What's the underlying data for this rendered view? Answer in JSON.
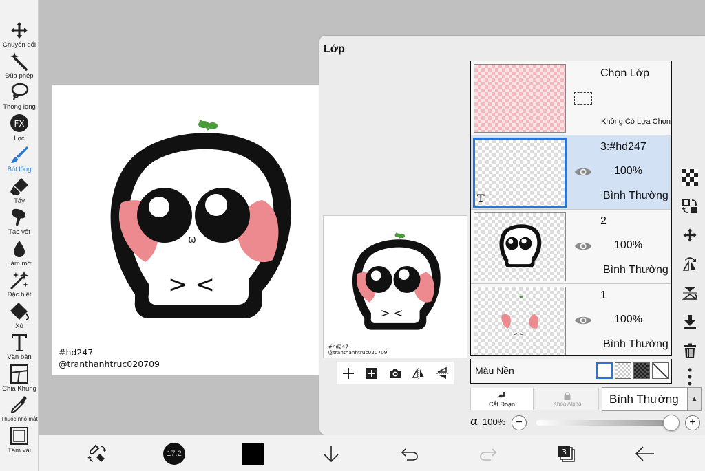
{
  "tools": [
    {
      "label": "Chuyển đổi",
      "icon": "move-arrows-icon",
      "active": false
    },
    {
      "label": "Đũa phép",
      "icon": "magic-wand-icon",
      "active": false
    },
    {
      "label": "Thòng lọng",
      "icon": "lasso-icon",
      "active": false
    },
    {
      "label": "Lọc",
      "icon": "fx-filter-icon",
      "active": false
    },
    {
      "label": "Bút lông",
      "icon": "brush-icon",
      "active": true
    },
    {
      "label": "Tẩy",
      "icon": "eraser-icon",
      "active": false
    },
    {
      "label": "Tạo vết",
      "icon": "smudge-icon",
      "active": false
    },
    {
      "label": "Làm mờ",
      "icon": "blur-drop-icon",
      "active": false
    },
    {
      "label": "Đặc biệt",
      "icon": "sparkle-icon",
      "active": false
    },
    {
      "label": "Xô",
      "icon": "bucket-icon",
      "active": false
    },
    {
      "label": "Văn bản",
      "icon": "text-t-icon",
      "active": false
    },
    {
      "label": "Chia Khung",
      "icon": "frame-divider-icon",
      "active": false
    },
    {
      "label": "Thuốc nhỏ mắt",
      "icon": "eyedropper-icon",
      "active": false
    },
    {
      "label": "Tấm vải",
      "icon": "canvas-icon",
      "active": false
    }
  ],
  "fx_text": "FX",
  "canvas": {
    "caption_line1": "#hd247",
    "caption_line2": "@tranthanhtruc020709",
    "face_text": "> <",
    "mouth_text": "ω"
  },
  "panel": {
    "title": "Lớp",
    "preview_caption_line1": "#hd247",
    "preview_caption_line2": "@tranthanhtruc020709",
    "selection_row": {
      "title": "Chọn Lớp",
      "subtitle": "Không Có Lựa Chọn"
    },
    "layers": [
      {
        "name": "3:#hd247",
        "opacity": "100%",
        "mode": "Bình Thường",
        "selected": true,
        "type_marker": "T"
      },
      {
        "name": "2",
        "opacity": "100%",
        "mode": "Bình Thường",
        "selected": false
      },
      {
        "name": "1",
        "opacity": "100%",
        "mode": "Bình Thường",
        "selected": false
      }
    ],
    "background_label": "Màu Nền",
    "cut_label": "Cắt Đoạn",
    "alpha_lock_label": "Khóa Alpha",
    "blend_mode": "Bình Thường",
    "alpha_symbol": "α",
    "alpha_value": "100%",
    "alpha_fraction": 1.0,
    "minus": "−",
    "plus": "+"
  },
  "bottom": {
    "brush_size": "17.2",
    "layer_count": "3",
    "primary_color": "#000000"
  },
  "colors": {
    "accent": "#2979d9",
    "selected_row": "#d3e1f5",
    "blush": "#ec8a8f",
    "sprout": "#4a9a3a"
  }
}
